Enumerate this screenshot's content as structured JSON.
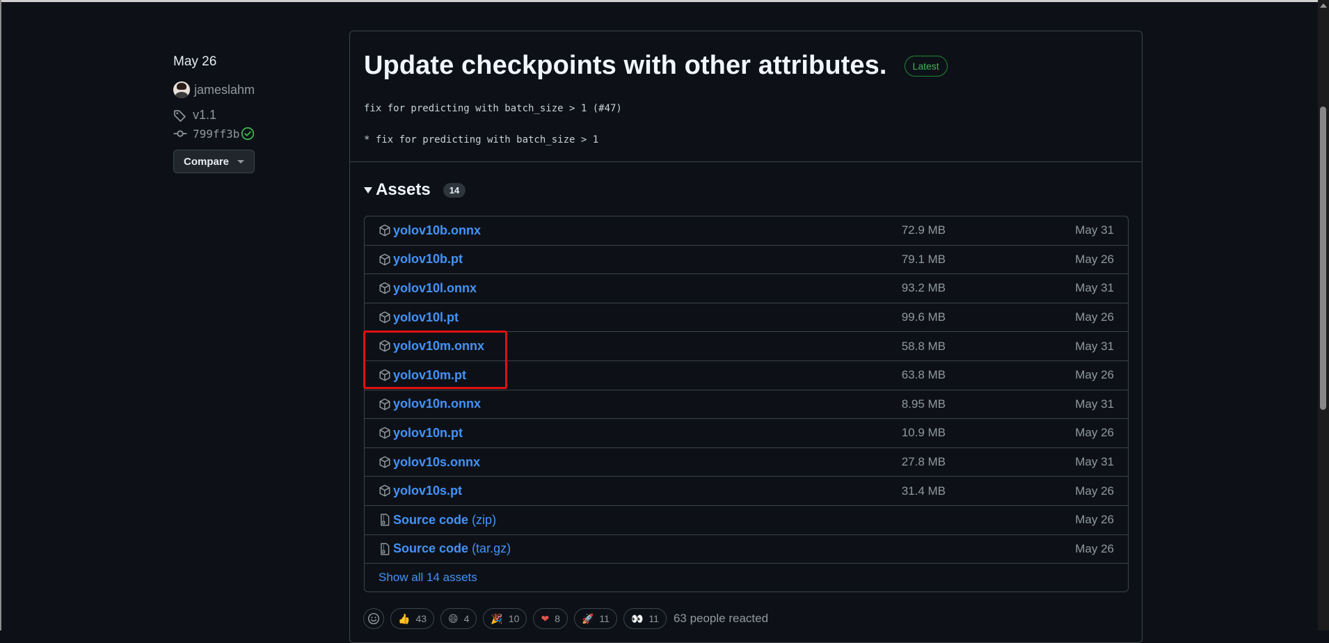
{
  "sidebar": {
    "date": "May 26",
    "author": "jameslahm",
    "tag": "v1.1",
    "commit": "799ff3b",
    "compare_label": "Compare"
  },
  "release": {
    "title": "Update checkpoints with other attributes.",
    "badge": "Latest",
    "body_lines": [
      "fix for predicting with batch_size > 1 (#47)",
      "* fix for predicting with batch_size > 1"
    ]
  },
  "assets": {
    "title": "Assets",
    "count": "14",
    "items": [
      {
        "name": "yolov10b.onnx",
        "size": "72.9 MB",
        "date": "May 31"
      },
      {
        "name": "yolov10b.pt",
        "size": "79.1 MB",
        "date": "May 26"
      },
      {
        "name": "yolov10l.onnx",
        "size": "93.2 MB",
        "date": "May 31"
      },
      {
        "name": "yolov10l.pt",
        "size": "99.6 MB",
        "date": "May 26"
      },
      {
        "name": "yolov10m.onnx",
        "size": "58.8 MB",
        "date": "May 31"
      },
      {
        "name": "yolov10m.pt",
        "size": "63.8 MB",
        "date": "May 26"
      },
      {
        "name": "yolov10n.onnx",
        "size": "8.95 MB",
        "date": "May 31"
      },
      {
        "name": "yolov10n.pt",
        "size": "10.9 MB",
        "date": "May 26"
      },
      {
        "name": "yolov10s.onnx",
        "size": "27.8 MB",
        "date": "May 31"
      },
      {
        "name": "yolov10s.pt",
        "size": "31.4 MB",
        "date": "May 26"
      }
    ],
    "source_items": [
      {
        "name": "Source code",
        "ext": "(zip)",
        "date": "May 26"
      },
      {
        "name": "Source code",
        "ext": "(tar.gz)",
        "date": "May 26"
      }
    ],
    "show_all": "Show all 14 assets"
  },
  "reactions": {
    "items": [
      {
        "icon": "thumbs-up",
        "emoji": "👍",
        "count": "43"
      },
      {
        "icon": "laugh",
        "emoji": "😄",
        "count": "4"
      },
      {
        "icon": "hooray",
        "emoji": "🎉",
        "count": "10"
      },
      {
        "icon": "heart",
        "emoji": "❤",
        "count": "8"
      },
      {
        "icon": "rocket",
        "emoji": "🚀",
        "count": "11"
      },
      {
        "icon": "eyes",
        "emoji": "👀",
        "count": "11"
      }
    ],
    "summary": "63 people reacted"
  },
  "colors": {
    "background": "#0d1117",
    "link": "#4493f8",
    "muted": "#9198a1",
    "latest": "#3fb950",
    "highlight": "#e01010"
  }
}
